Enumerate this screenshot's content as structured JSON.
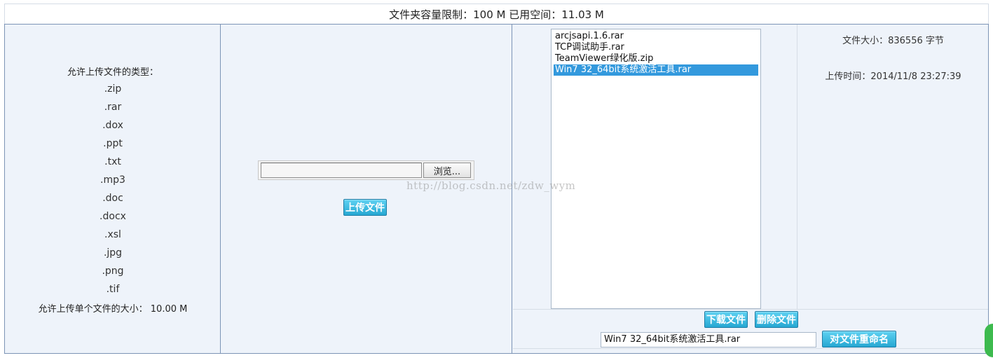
{
  "header": {
    "quota_text": "文件夹容量限制：100 M 已用空间：11.03 M"
  },
  "allowed": {
    "heading": "允许上传文件的类型：",
    "types": [
      ".zip",
      ".rar",
      ".dox",
      ".ppt",
      ".txt",
      ".mp3",
      ".doc",
      ".docx",
      ".xsl",
      ".jpg",
      ".png",
      ".tif"
    ],
    "size_note": "允许上传单个文件的大小： 10.00 M"
  },
  "upload": {
    "browse_label": "浏览...",
    "upload_label": "上传文件"
  },
  "files": {
    "items": [
      {
        "name": "arcjsapi.1.6.rar",
        "selected": false
      },
      {
        "name": "TCP调试助手.rar",
        "selected": false
      },
      {
        "name": "TeamViewer绿化版.zip",
        "selected": false
      },
      {
        "name": "Win7 32_64bit系统激活工具.rar",
        "selected": true
      }
    ],
    "size_text": "文件大小：836556 字节",
    "time_text": "上传时间：2014/11/8 23:27:39",
    "download_label": "下载文件",
    "delete_label": "删除文件",
    "rename_value": "Win7 32_64bit系统激活工具.rar",
    "rename_label": "对文件重命名"
  },
  "watermark": "http://blog.csdn.net/zdw_wym",
  "colors": {
    "panel_bg": "#eef3fa",
    "button_blue": "#26a7d2",
    "selection_blue": "#3399dd"
  }
}
